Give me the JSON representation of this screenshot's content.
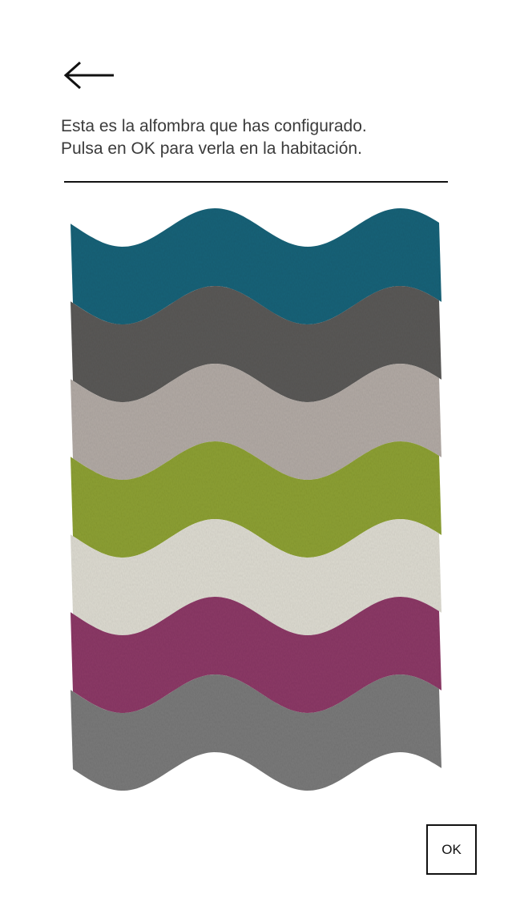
{
  "header": {
    "back_icon": "arrow-left-icon"
  },
  "message": {
    "line1": "Esta es la alfombra que has configurado.",
    "line2": "Pulsa en OK para verla en la habitación."
  },
  "rug": {
    "stripes": [
      {
        "color": "#1f6479"
      },
      {
        "color": "#5b5a58"
      },
      {
        "color": "#b3aba6"
      },
      {
        "color": "#8ea136"
      },
      {
        "color": "#dedcd2"
      },
      {
        "color": "#8d3a67"
      },
      {
        "color": "#7a7a7a"
      }
    ]
  },
  "actions": {
    "ok_label": "OK"
  }
}
